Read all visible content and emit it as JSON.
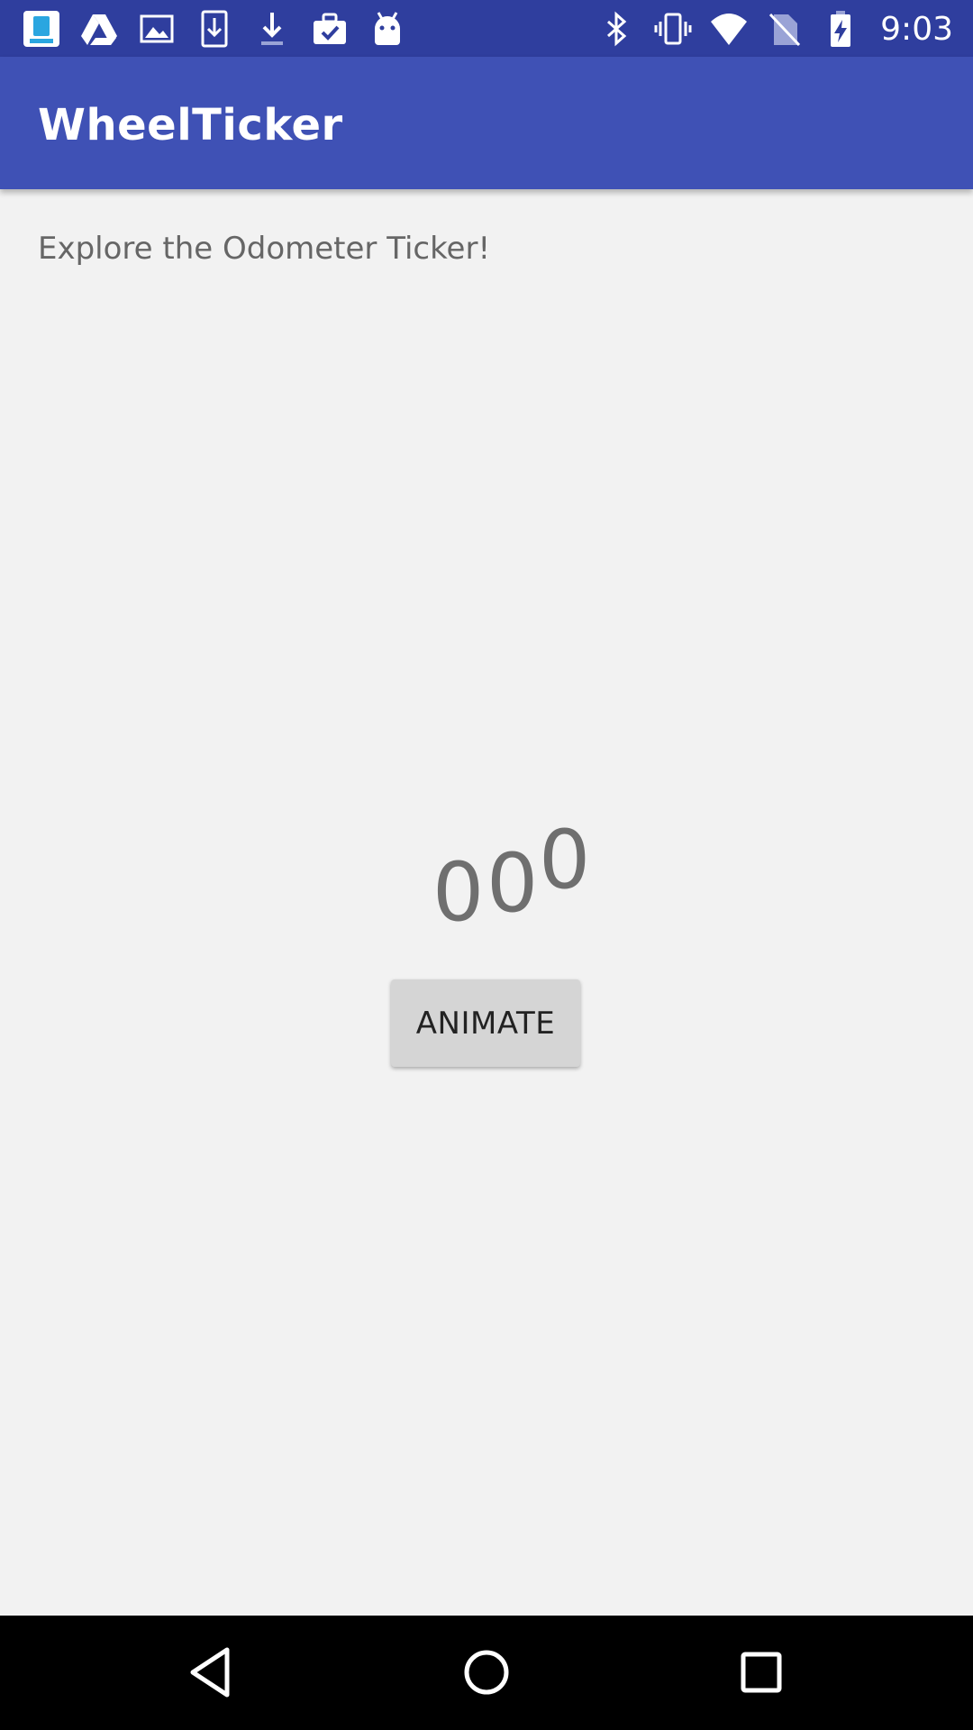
{
  "status_bar": {
    "time": "9:03",
    "left_icons": [
      "boston-app-icon",
      "drive-icon",
      "image-icon",
      "download-box-icon",
      "download-icon",
      "briefcase-check-icon",
      "android-icon"
    ],
    "right_icons": [
      "bluetooth-icon",
      "vibrate-icon",
      "wifi-icon",
      "no-sim-icon",
      "battery-charging-icon"
    ],
    "color": "#2f3e9e"
  },
  "app_bar": {
    "title": "WheelTicker",
    "color": "#3f51b5"
  },
  "content": {
    "intro": "Explore the Odometer Ticker!",
    "ticker_digits": [
      "0",
      "0",
      "0"
    ],
    "animate_button": "ANIMATE"
  },
  "nav_bar": {
    "icons": [
      "back-icon",
      "home-icon",
      "recents-icon"
    ]
  }
}
